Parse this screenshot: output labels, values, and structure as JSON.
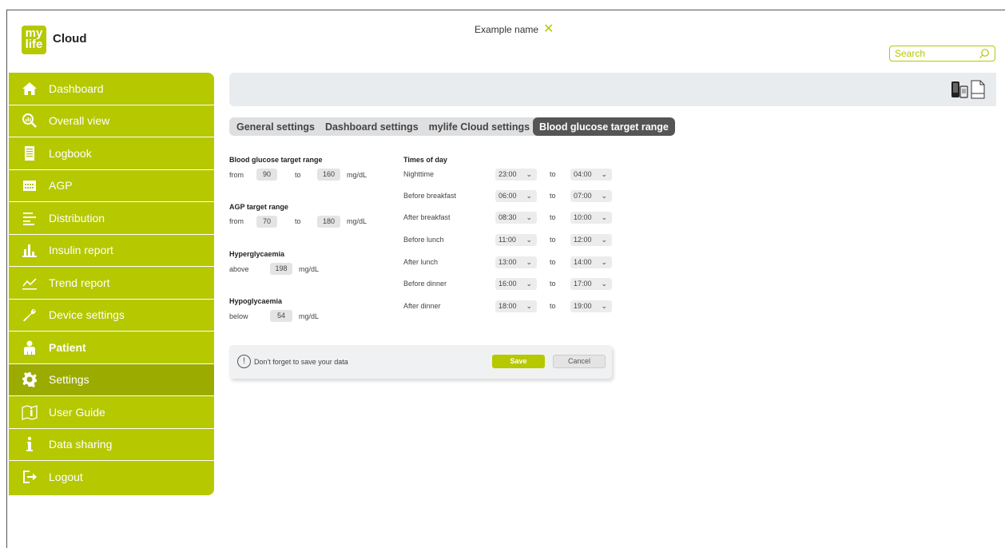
{
  "header": {
    "logo_text_top": "my",
    "logo_text_bottom": "life",
    "brand": "Cloud",
    "patient_name": "Example name",
    "search_placeholder": "Search"
  },
  "colors": {
    "accent": "#b5c800",
    "accent_dark": "#9bab00",
    "tab_active": "#555555"
  },
  "sidebar": {
    "items": [
      {
        "label": "Dashboard",
        "icon": "home-icon"
      },
      {
        "label": "Overall view",
        "icon": "magnify-chart-icon"
      },
      {
        "label": "Logbook",
        "icon": "logbook-icon"
      },
      {
        "label": "AGP",
        "icon": "calendar-icon"
      },
      {
        "label": "Distribution",
        "icon": "distribution-icon"
      },
      {
        "label": "Insulin report",
        "icon": "bar-chart-icon"
      },
      {
        "label": "Trend report",
        "icon": "trend-icon"
      },
      {
        "label": "Device settings",
        "icon": "wrench-icon"
      },
      {
        "label": "Patient",
        "icon": "person-icon"
      },
      {
        "label": "Settings",
        "icon": "gear-icon"
      },
      {
        "label": "User Guide",
        "icon": "book-icon"
      },
      {
        "label": "Data sharing",
        "icon": "info-icon"
      },
      {
        "label": "Logout",
        "icon": "logout-icon"
      }
    ],
    "active": "Settings"
  },
  "tabs": [
    {
      "label": "General settings"
    },
    {
      "label": "Dashboard settings"
    },
    {
      "label": "mylife Cloud settings"
    },
    {
      "label": "Blood glucose target range"
    }
  ],
  "active_tab": "Blood glucose target range",
  "bg_target": {
    "heading": "Blood glucose target range",
    "from_label": "from",
    "from_value": "90",
    "to_label": "to",
    "to_value": "160",
    "unit": "mg/dL"
  },
  "agp_target": {
    "heading": "AGP target range",
    "from_label": "from",
    "from_value": "70",
    "to_label": "to",
    "to_value": "180",
    "unit": "mg/dL"
  },
  "hyper": {
    "heading": "Hyperglycaemia",
    "label": "above",
    "value": "198",
    "unit": "mg/dL"
  },
  "hypo": {
    "heading": "Hypoglycaemia",
    "label": "below",
    "value": "54",
    "unit": "mg/dL"
  },
  "times": {
    "heading": "Times of day",
    "to_label": "to",
    "rows": [
      {
        "label": "Nighttime",
        "from": "23:00",
        "to": "04:00"
      },
      {
        "label": "Before breakfast",
        "from": "06:00",
        "to": "07:00"
      },
      {
        "label": "After breakfast",
        "from": "08:30",
        "to": "10:00"
      },
      {
        "label": "Before lunch",
        "from": "11:00",
        "to": "12:00"
      },
      {
        "label": "After lunch",
        "from": "13:00",
        "to": "14:00"
      },
      {
        "label": "Before dinner",
        "from": "16:00",
        "to": "17:00"
      },
      {
        "label": "After dinner",
        "from": "18:00",
        "to": "19:00"
      }
    ]
  },
  "savebar": {
    "warning_icon": "!",
    "message": "Don't forget to save your data",
    "save_label": "Save",
    "cancel_label": "Cancel"
  }
}
